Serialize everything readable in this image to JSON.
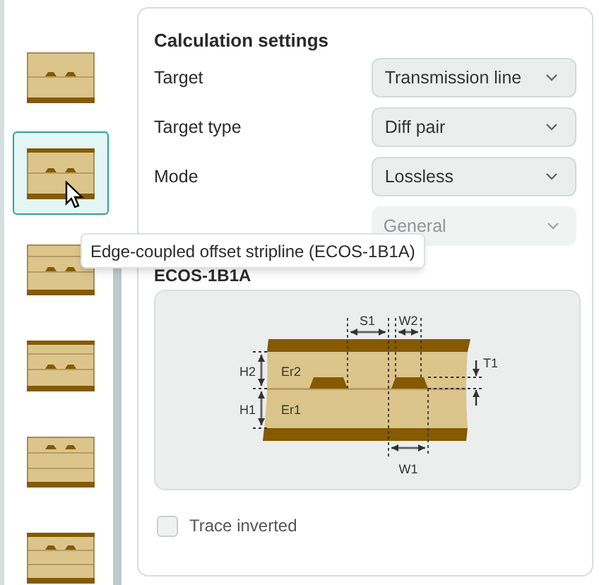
{
  "sidebar": {
    "items": [
      {
        "kind": "surface-pair",
        "selected": false
      },
      {
        "kind": "covered-pair",
        "selected": true
      },
      {
        "kind": "embedded-pair",
        "selected": false
      },
      {
        "kind": "embedded-covered-pair",
        "selected": false
      },
      {
        "kind": "top-pair",
        "selected": false
      },
      {
        "kind": "top-covered-pair",
        "selected": false
      }
    ]
  },
  "tooltip": {
    "text": "Edge-coupled offset stripline (ECOS-1B1A)"
  },
  "settings": {
    "title": "Calculation settings",
    "rows": [
      {
        "label": "Target",
        "value": "Transmission line",
        "disabled": false
      },
      {
        "label": "Target type",
        "value": "Diff pair",
        "disabled": false
      },
      {
        "label": "Mode",
        "value": "Lossless",
        "disabled": false
      },
      {
        "value": "General",
        "disabled": true
      }
    ]
  },
  "structure": {
    "title": "ECOS-1B1A",
    "labels": [
      "S1",
      "W2",
      "T1",
      "H2",
      "Er2",
      "H1",
      "Er1",
      "W1"
    ]
  },
  "trace_inverted": {
    "label": "Trace inverted",
    "checked": false
  }
}
